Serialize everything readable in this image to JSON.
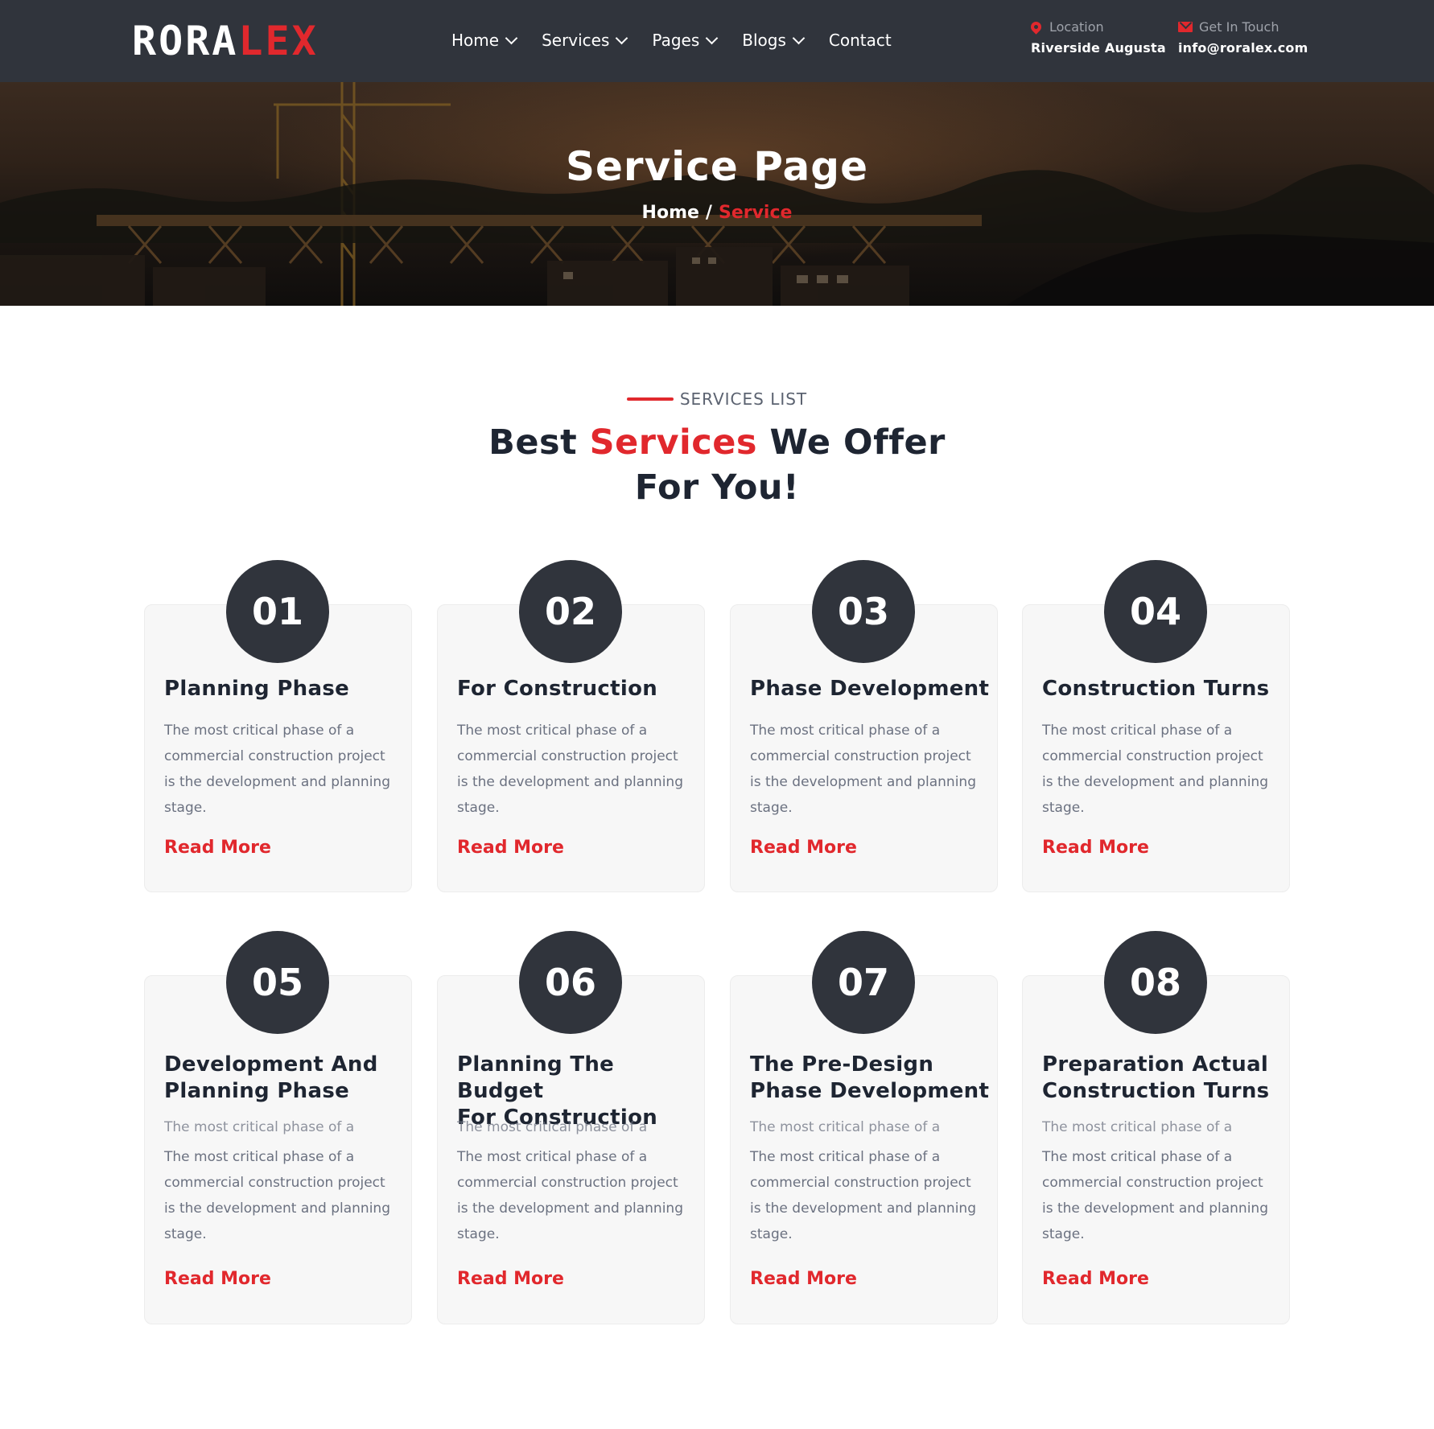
{
  "header": {
    "logo_white": "RORA",
    "logo_red": "LEX",
    "nav": [
      {
        "label": "Home",
        "dropdown": true
      },
      {
        "label": "Services",
        "dropdown": true
      },
      {
        "label": "Pages",
        "dropdown": true
      },
      {
        "label": "Blogs",
        "dropdown": true
      },
      {
        "label": "Contact",
        "dropdown": false
      }
    ],
    "location": {
      "label": "Location",
      "value": "Riverside Augusta",
      "icon": "map-pin-icon"
    },
    "email": {
      "label": "Get In Touch",
      "value": "info@roralex.com",
      "icon": "envelope-icon"
    }
  },
  "banner": {
    "title": "Service Page",
    "breadcrumb": {
      "home": "Home",
      "separator": "/",
      "current": "Service"
    }
  },
  "section": {
    "subtitle": "SERVICES LIST",
    "heading_part1": "Best ",
    "heading_highlight": "Services",
    "heading_part2": " We Offer",
    "heading_line2": "For You!"
  },
  "cards": [
    {
      "number": "01",
      "title_line1": "Planning Phase",
      "title_line2": "",
      "desc": "The most critical phase of a commercial construction project is the development and planning stage.",
      "link": "Read More"
    },
    {
      "number": "02",
      "title_line1": "For Construction",
      "title_line2": "",
      "desc": "The most critical phase of a commercial construction project is the development and planning stage.",
      "link": "Read More"
    },
    {
      "number": "03",
      "title_line1": "Phase Development",
      "title_line2": "",
      "desc": "The most critical phase of a commercial construction project is the development and planning stage.",
      "link": "Read More"
    },
    {
      "number": "04",
      "title_line1": "Construction Turns",
      "title_line2": "",
      "desc": "The most critical phase of a commercial construction project is the development and planning stage.",
      "link": "Read More"
    },
    {
      "number": "05",
      "title_line1": "Development And",
      "title_line2": "Planning Phase",
      "desc_ghost": "The most critical phase of a commercial construction project",
      "desc": "The most critical phase of a commercial construction project is the development and planning stage.",
      "link": "Read More"
    },
    {
      "number": "06",
      "title_line1": "Planning The Budget",
      "title_line2": "For Construction",
      "desc_ghost": "The most critical phase of a commercial construction project",
      "desc": "The most critical phase of a commercial construction project is the development and planning stage.",
      "link": "Read More"
    },
    {
      "number": "07",
      "title_line1": "The Pre-Design",
      "title_line2": "Phase Development",
      "desc_ghost": "The most critical phase of a commercial construction project",
      "desc": "The most critical phase of a commercial construction project is the development and planning stage.",
      "link": "Read More"
    },
    {
      "number": "08",
      "title_line1": "Preparation Actual",
      "title_line2": "Construction Turns",
      "desc_ghost": "The most critical phase of a commercial construction project",
      "desc": "The most critical phase of a commercial construction project is the development and planning stage.",
      "link": "Read More"
    }
  ]
}
